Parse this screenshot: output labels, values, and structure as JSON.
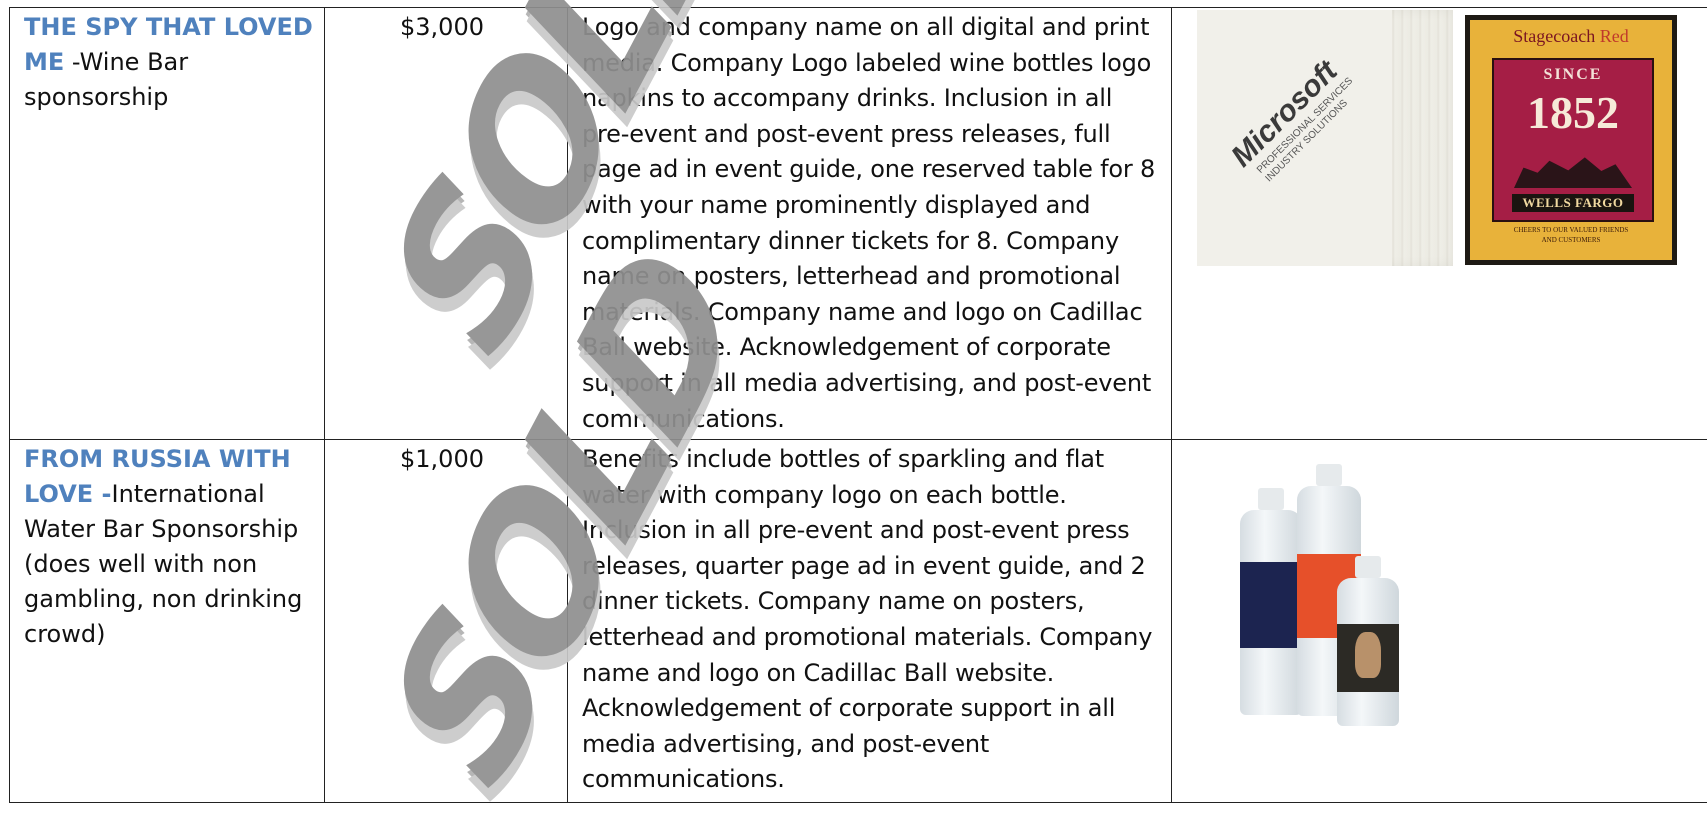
{
  "rows": [
    {
      "title": "THE SPY THAT LOVED ME",
      "subtitle": " -Wine Bar sponsorship",
      "price": "$3,000",
      "benefits": "Logo and company name on all digital and print media. Company Logo labeled wine bottles logo napkins to accompany drinks.  Inclusion in all pre-event and post-event press releases, full page ad in event guide,  one reserved table for 8 with your name prominently displayed and complimentary dinner tickets for 8. Company name on posters, letterhead and promotional materials. Company name and logo on Cadillac Ball website. Acknowledgement of corporate support in all media advertising, and post-event communications.",
      "stamp": "SOLD",
      "napkin": {
        "brand": "Microsoft",
        "line1": "PROFESSIONAL SERVICES",
        "line2": "INDUSTRY SOLUTIONS"
      },
      "wine_label": {
        "brand_a": "Stagecoach",
        "brand_b": "Red",
        "since": "SINCE",
        "year": "1852",
        "maker": "WELLS FARGO",
        "cheers_1": "CHEERS TO OUR VALUED FRIENDS",
        "cheers_2": "AND CUSTOMERS"
      }
    },
    {
      "title": "FROM RUSSIA WITH LOVE -",
      "subtitle": "International Water Bar Sponsorship (does well with non gambling, non drinking crowd)",
      "price": "$1,000",
      "benefits": "Benefits include bottles of sparkling and flat water with company logo on each bottle. Inclusion in all pre-event and post-event press releases, quarter page ad in event guide, and  2 dinner tickets.  Company name on posters, letterhead and promotional materials. Company name and logo on Cadillac Ball website. Acknowledgement of corporate support in all media advertising, and post-event communications.",
      "stamp": "SOLD"
    }
  ],
  "colors": {
    "title": "#4f81bd",
    "stamp": "#8f8f8f",
    "border": "#222222"
  }
}
